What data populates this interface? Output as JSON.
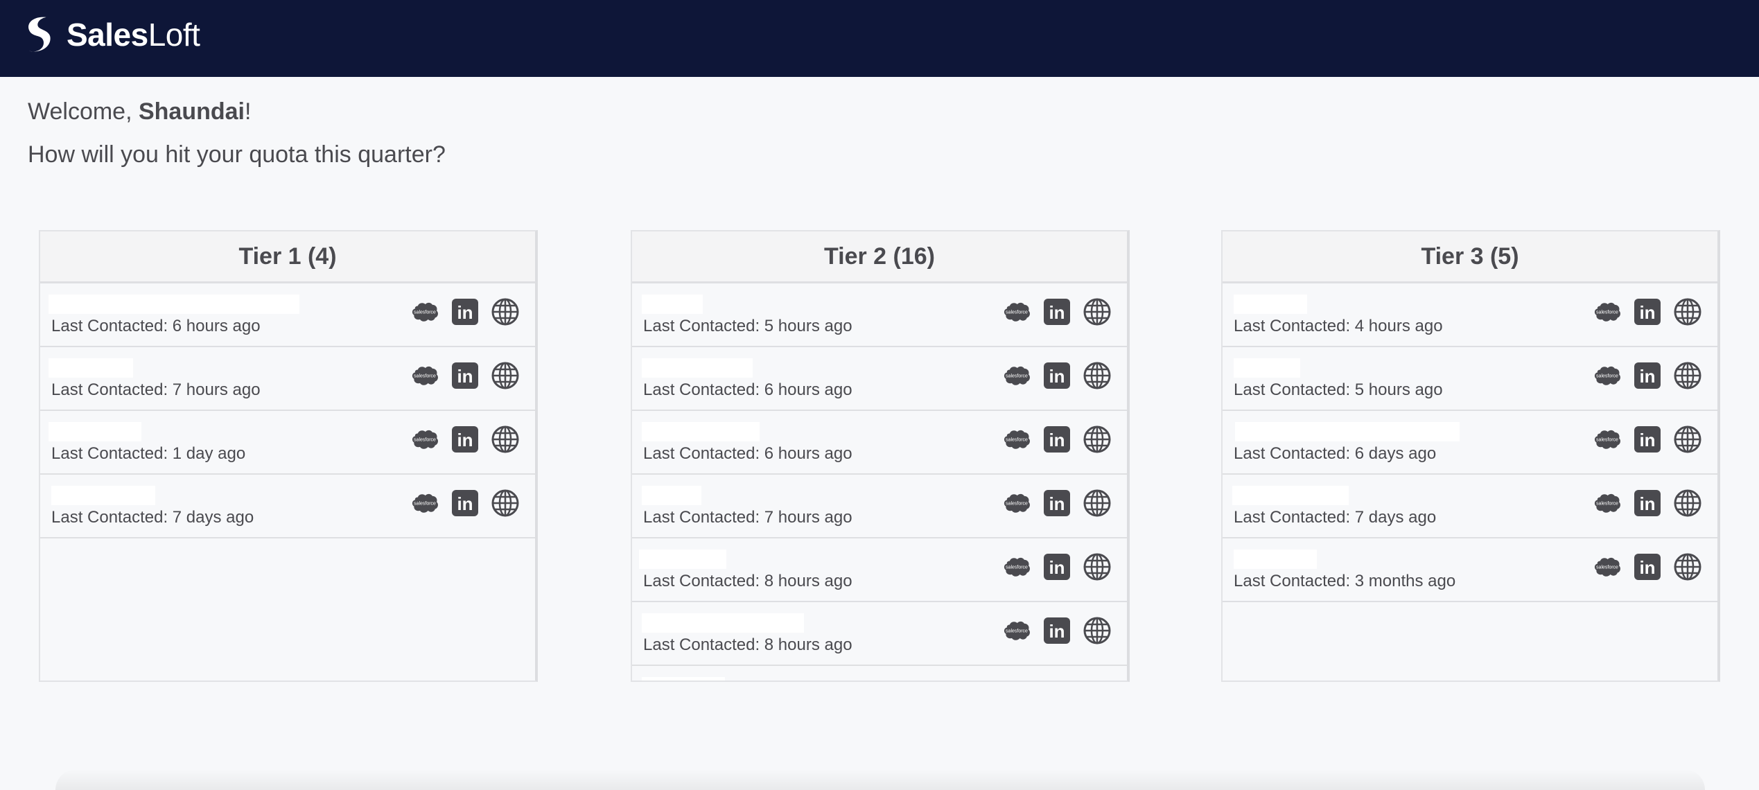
{
  "app": {
    "name_bold": "Sales",
    "name_light": "Loft"
  },
  "welcome": {
    "prefix": "Welcome, ",
    "user": "Shaundai",
    "suffix": "!"
  },
  "question": "How will you hit your quota this quarter?",
  "icon_names": {
    "salesforce": "salesforce-icon",
    "linkedin": "linkedin-icon",
    "website": "globe-icon"
  },
  "salesforce_icon_text": "salesforce",
  "linkedin_icon_text": "in",
  "colors": {
    "topbar": "#0e1638",
    "icon": "#4a4a4f",
    "background": "#f7f8fa"
  },
  "tiers": [
    {
      "title": "Tier 1 (4)",
      "rows": [
        {
          "last_contacted": "Last Contacted: 6 hours ago"
        },
        {
          "last_contacted": "Last Contacted: 7 hours ago"
        },
        {
          "last_contacted": "Last Contacted: 1 day ago"
        },
        {
          "last_contacted": "Last Contacted: 7 days ago"
        }
      ]
    },
    {
      "title": "Tier 2 (16)",
      "rows": [
        {
          "last_contacted": "Last Contacted: 5 hours ago"
        },
        {
          "last_contacted": "Last Contacted: 6 hours ago"
        },
        {
          "last_contacted": "Last Contacted: 6 hours ago"
        },
        {
          "last_contacted": "Last Contacted: 7 hours ago"
        },
        {
          "last_contacted": "Last Contacted: 8 hours ago"
        },
        {
          "last_contacted": "Last Contacted: 8 hours ago"
        },
        {
          "last_contacted": ""
        }
      ]
    },
    {
      "title": "Tier 3 (5)",
      "rows": [
        {
          "last_contacted": "Last Contacted: 4 hours ago"
        },
        {
          "last_contacted": "Last Contacted: 5 hours ago"
        },
        {
          "last_contacted": "Last Contacted: 6 days ago"
        },
        {
          "last_contacted": "Last Contacted: 7 days ago"
        },
        {
          "last_contacted": "Last Contacted: 3 months ago"
        }
      ]
    }
  ]
}
